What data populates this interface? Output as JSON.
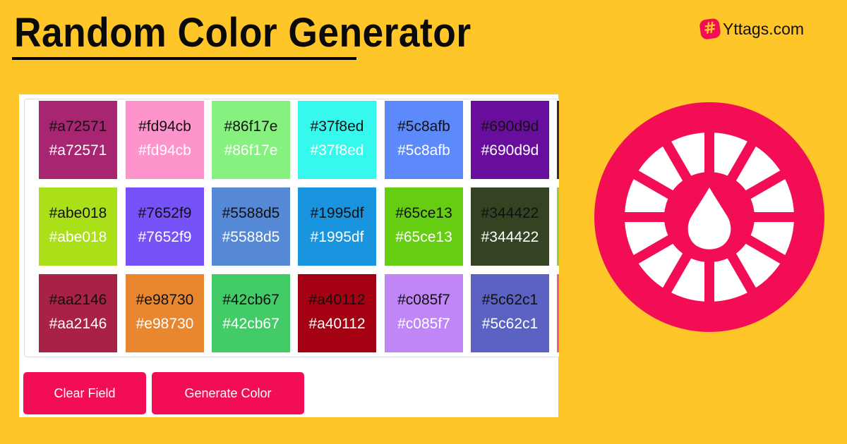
{
  "header": {
    "title": "Random Color Generator",
    "brand_name": "Yttags.com",
    "brand_icon": "hashtag-icon",
    "brand_icon_glyph": "#"
  },
  "colors": {
    "background": "#FFC629",
    "accent": "#F20D55",
    "panel": "#FFFFFF"
  },
  "swatches": [
    {
      "hex": "#a72571",
      "dark_label": "#a72571",
      "light_label": "#a72571"
    },
    {
      "hex": "#fd94cb",
      "dark_label": "#fd94cb",
      "light_label": "#fd94cb"
    },
    {
      "hex": "#86f17e",
      "dark_label": "#86f17e",
      "light_label": "#86f17e"
    },
    {
      "hex": "#37f8ed",
      "dark_label": "#37f8ed",
      "light_label": "#37f8ed"
    },
    {
      "hex": "#5c8afb",
      "dark_label": "#5c8afb",
      "light_label": "#5c8afb"
    },
    {
      "hex": "#690d9d",
      "dark_label": "#690d9d",
      "light_label": "#690d9d"
    },
    {
      "hex": "#abe018",
      "dark_label": "#abe018",
      "light_label": "#abe018"
    },
    {
      "hex": "#7652f9",
      "dark_label": "#7652f9",
      "light_label": "#7652f9"
    },
    {
      "hex": "#5588d5",
      "dark_label": "#5588d5",
      "light_label": "#5588d5"
    },
    {
      "hex": "#1995df",
      "dark_label": "#1995df",
      "light_label": "#1995df"
    },
    {
      "hex": "#65ce13",
      "dark_label": "#65ce13",
      "light_label": "#65ce13"
    },
    {
      "hex": "#344422",
      "dark_label": "#344422",
      "light_label": "#344422"
    },
    {
      "hex": "#aa2146",
      "dark_label": "#aa2146",
      "light_label": "#aa2146"
    },
    {
      "hex": "#e98730",
      "dark_label": "#e98730",
      "light_label": "#e98730"
    },
    {
      "hex": "#42cb67",
      "dark_label": "#42cb67",
      "light_label": "#42cb67"
    },
    {
      "hex": "#a40112",
      "dark_label": "#a40112",
      "light_label": "#a40112"
    },
    {
      "hex": "#c085f7",
      "dark_label": "#c085f7",
      "light_label": "#c085f7"
    },
    {
      "hex": "#5c62c1",
      "dark_label": "#5c62c1",
      "light_label": "#5c62c1"
    }
  ],
  "partial_swatch_colors": [
    "#3a2a3a",
    "#8fcf4a",
    "#f25a8e"
  ],
  "buttons": {
    "clear": "Clear Field",
    "generate": "Generate Color"
  },
  "illustration": {
    "icon": "color-wheel-drop-icon"
  }
}
